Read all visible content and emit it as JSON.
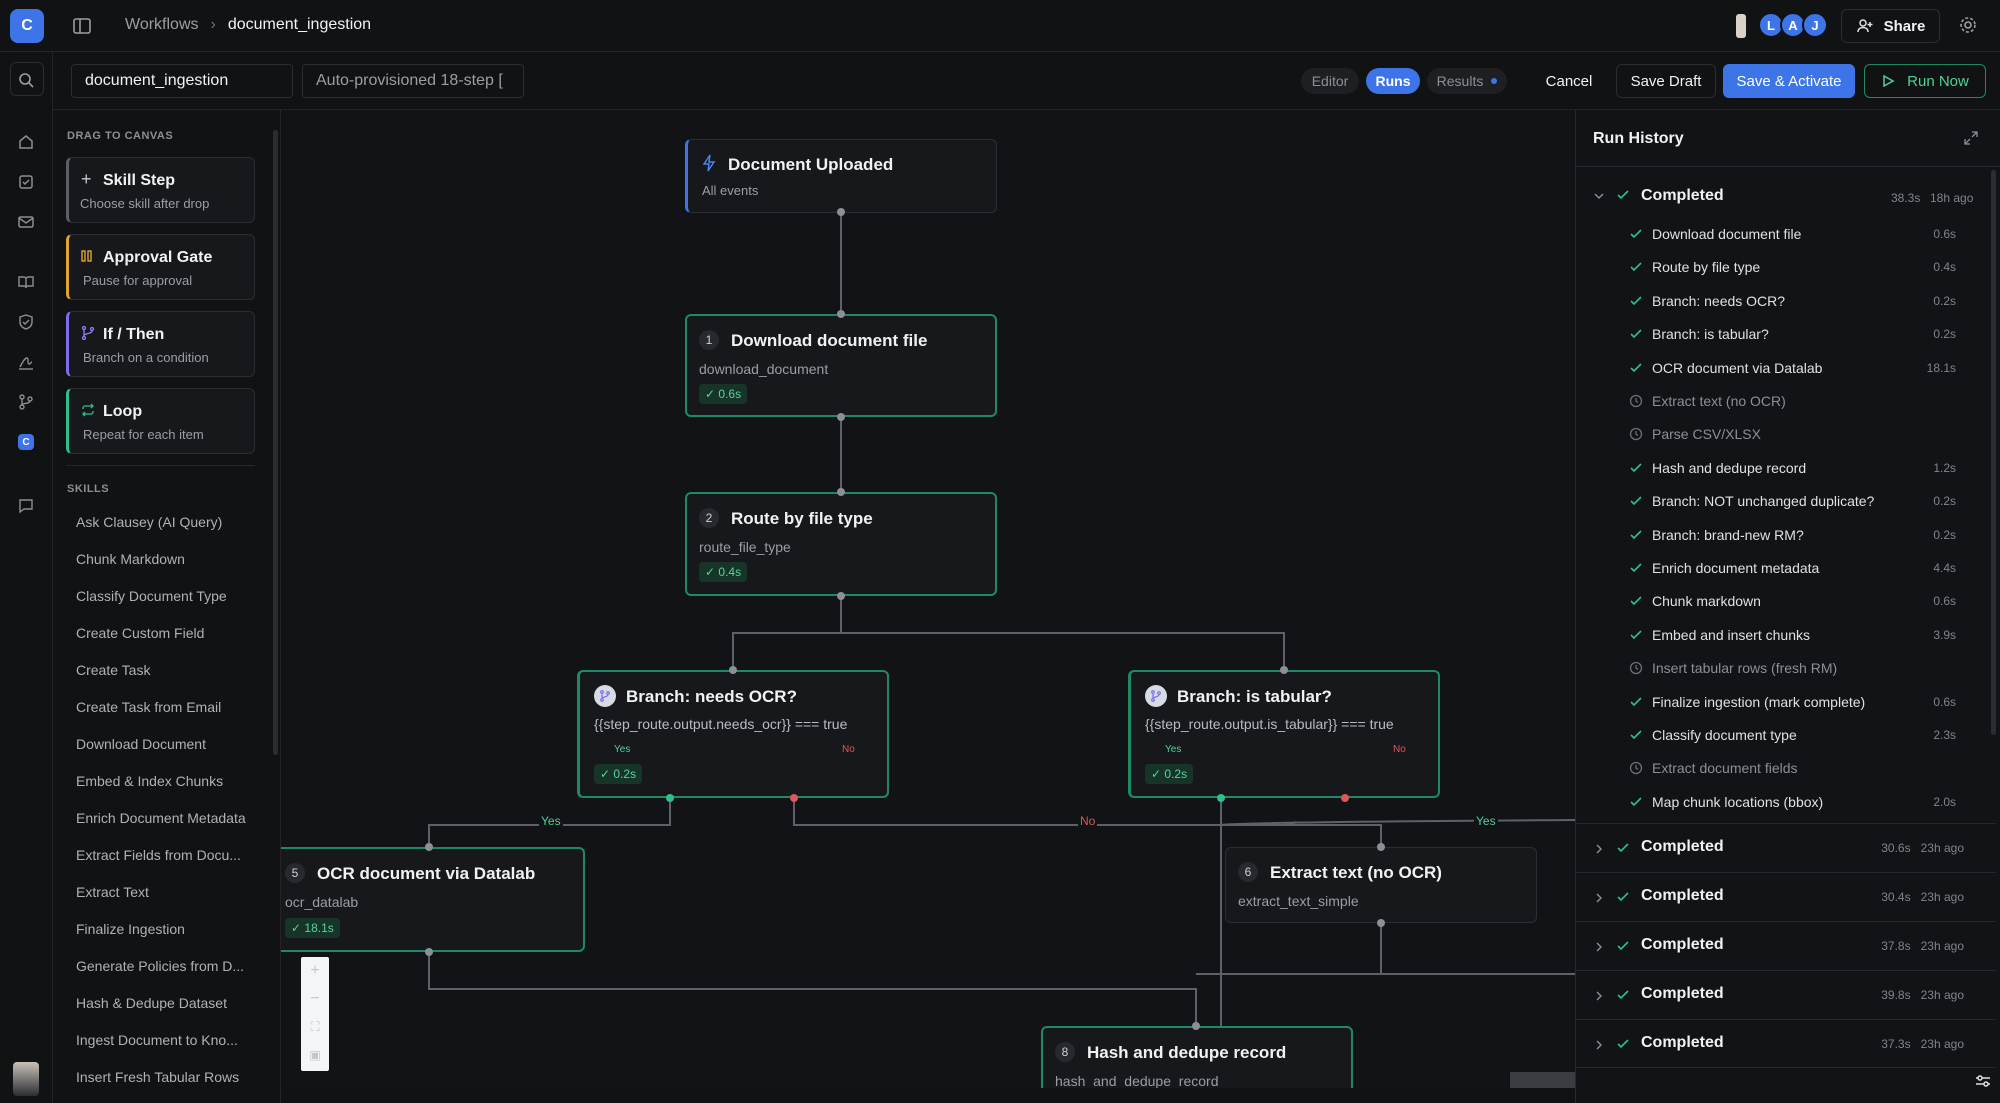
{
  "app": {
    "logo_letter": "C"
  },
  "breadcrumb": {
    "root": "Workflows",
    "current": "document_ingestion"
  },
  "header": {
    "avatars": [
      "L",
      "A",
      "J"
    ],
    "share_label": "Share"
  },
  "toolbar": {
    "name_value": "document_ingestion",
    "description_value": "Auto-provisioned 18-step [",
    "tabs": [
      "Editor",
      "Runs",
      "Results"
    ],
    "active_tab": "Runs",
    "cancel_label": "Cancel",
    "save_draft_label": "Save Draft",
    "save_activate_label": "Save & Activate",
    "run_now_label": "Run Now"
  },
  "palette": {
    "heading": "DRAG TO CANVAS",
    "blocks": [
      {
        "title": "Skill Step",
        "subtitle": "Choose skill after drop",
        "accent": "#5b5f66"
      },
      {
        "title": "Approval Gate",
        "subtitle": "Pause for approval",
        "accent": "#e0a431"
      },
      {
        "title": "If / Then",
        "subtitle": "Branch on a condition",
        "accent": "#7d6bf0"
      },
      {
        "title": "Loop",
        "subtitle": "Repeat for each item",
        "accent": "#2fbf8c"
      }
    ],
    "skills_heading": "SKILLS",
    "skills": [
      "Ask Clausey (AI Query)",
      "Chunk Markdown",
      "Classify Document Type",
      "Create Custom Field",
      "Create Task",
      "Create Task from Email",
      "Download Document",
      "Embed & Index Chunks",
      "Enrich Document Metadata",
      "Extract Fields from Docu...",
      "Extract Text",
      "Finalize Ingestion",
      "Generate Policies from D...",
      "Hash & Dedupe Dataset",
      "Ingest Document to Kno...",
      "Insert Fresh Tabular Rows"
    ]
  },
  "canvas": {
    "trigger": {
      "title": "Document Uploaded",
      "subtitle": "All events"
    },
    "nodes": [
      {
        "num": "1",
        "title": "Download document file",
        "subtitle": "download_document",
        "duration": "✓ 0.6s"
      },
      {
        "num": "2",
        "title": "Route by file type",
        "subtitle": "route_file_type",
        "duration": "✓ 0.4s"
      },
      {
        "title": "Branch: needs OCR?",
        "subtitle": "{{step_route.output.needs_ocr}} === true",
        "yes": "Yes",
        "no": "No",
        "duration": "✓ 0.2s"
      },
      {
        "title": "Branch: is tabular?",
        "subtitle": "{{step_route.output.is_tabular}} === true",
        "yes": "Yes",
        "no": "No",
        "duration": "✓ 0.2s"
      },
      {
        "num": "5",
        "title": "OCR document via Datalab",
        "subtitle": "ocr_datalab",
        "duration": "✓ 18.1s"
      },
      {
        "num": "6",
        "title": "Extract text (no OCR)",
        "subtitle": "extract_text_simple"
      },
      {
        "num": "8",
        "title": "Hash and dedupe record",
        "subtitle": "hash_and_dedupe_record"
      }
    ],
    "edge_labels": {
      "yes": "Yes",
      "no": "No"
    }
  },
  "history": {
    "title": "Run History",
    "expanded": {
      "status": "Completed",
      "duration": "38.3s",
      "ago": "18h ago",
      "steps": [
        {
          "label": "Download document file",
          "dur": "0.6s",
          "done": true
        },
        {
          "label": "Route by file type",
          "dur": "0.4s",
          "done": true
        },
        {
          "label": "Branch: needs OCR?",
          "dur": "0.2s",
          "done": true
        },
        {
          "label": "Branch: is tabular?",
          "dur": "0.2s",
          "done": true
        },
        {
          "label": "OCR document via Datalab",
          "dur": "18.1s",
          "done": true
        },
        {
          "label": "Extract text (no OCR)",
          "dur": "",
          "done": false
        },
        {
          "label": "Parse CSV/XLSX",
          "dur": "",
          "done": false
        },
        {
          "label": "Hash and dedupe record",
          "dur": "1.2s",
          "done": true
        },
        {
          "label": "Branch: NOT unchanged duplicate?",
          "dur": "0.2s",
          "done": true
        },
        {
          "label": "Branch: brand-new RM?",
          "dur": "0.2s",
          "done": true
        },
        {
          "label": "Enrich document metadata",
          "dur": "4.4s",
          "done": true
        },
        {
          "label": "Chunk markdown",
          "dur": "0.6s",
          "done": true
        },
        {
          "label": "Embed and insert chunks",
          "dur": "3.9s",
          "done": true
        },
        {
          "label": "Insert tabular rows (fresh RM)",
          "dur": "",
          "done": false
        },
        {
          "label": "Finalize ingestion (mark complete)",
          "dur": "0.6s",
          "done": true
        },
        {
          "label": "Classify document type",
          "dur": "2.3s",
          "done": true
        },
        {
          "label": "Extract document fields",
          "dur": "",
          "done": false
        },
        {
          "label": "Map chunk locations (bbox)",
          "dur": "2.0s",
          "done": true
        }
      ]
    },
    "runs": [
      {
        "status": "Completed",
        "duration": "30.6s",
        "ago": "23h ago"
      },
      {
        "status": "Completed",
        "duration": "30.4s",
        "ago": "23h ago"
      },
      {
        "status": "Completed",
        "duration": "37.8s",
        "ago": "23h ago"
      },
      {
        "status": "Completed",
        "duration": "39.8s",
        "ago": "23h ago"
      },
      {
        "status": "Completed",
        "duration": "37.3s",
        "ago": "23h ago"
      }
    ]
  },
  "colors": {
    "accent_blue": "#3d74e8",
    "success_green": "#1f8a62",
    "no_red": "#e0565b"
  }
}
